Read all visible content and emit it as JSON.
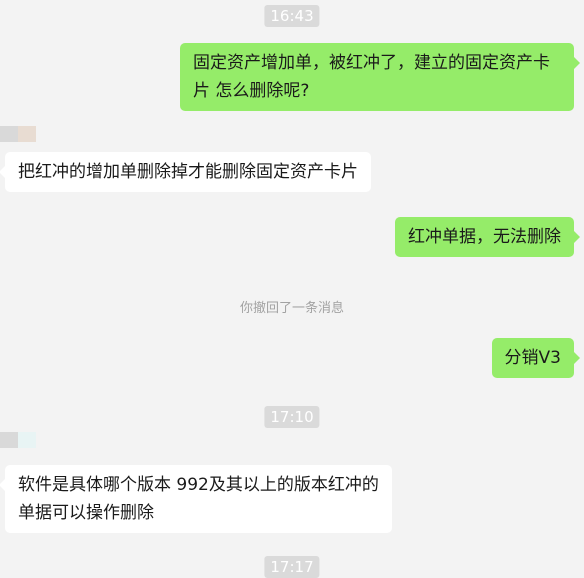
{
  "conversation": {
    "timestamps": [
      "16:43",
      "17:10",
      "17:17"
    ],
    "messages": [
      {
        "text": "固定资产增加单，被红冲了，建立的固定资产卡片  怎么删除呢?"
      },
      {
        "text": "把红冲的增加单删除掉才能删除固定资产卡片"
      },
      {
        "text": "红冲单据，无法删除"
      },
      {
        "text": "你撤回了一条消息"
      },
      {
        "text": "分销V3"
      },
      {
        "text": "软件是具体哪个版本 992及其以上的版本红冲的单据可以操作删除"
      }
    ]
  },
  "colors": {
    "outgoing_bubble": "#95ec69",
    "incoming_bubble": "#ffffff",
    "background": "#f3f3f3",
    "timestamp_bg": "#dadada"
  }
}
